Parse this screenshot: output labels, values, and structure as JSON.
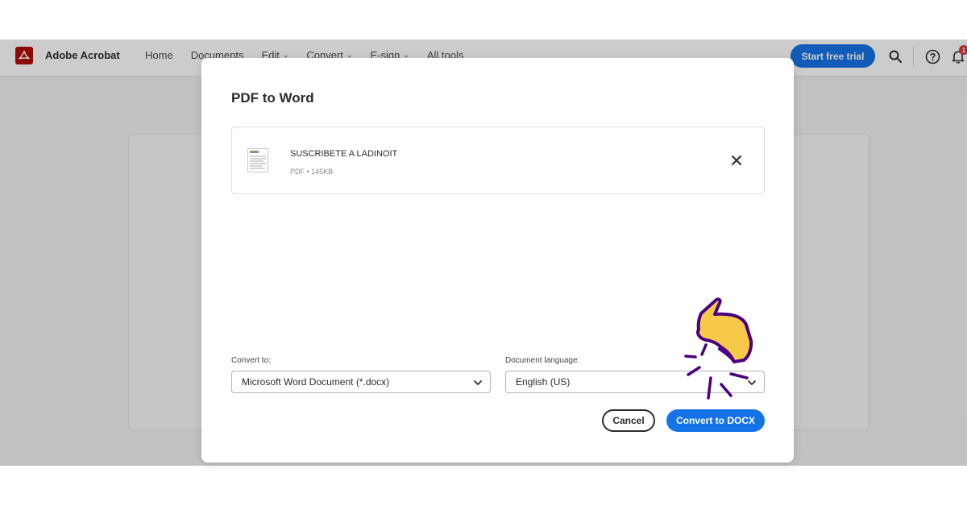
{
  "app": {
    "brand": "Adobe Acrobat",
    "brand_color": "#b30b00",
    "accent_color": "#1473e6",
    "logo_icon": "acrobat-logo-icon"
  },
  "nav": {
    "items": [
      {
        "label": "Home",
        "has_dropdown": false
      },
      {
        "label": "Documents",
        "has_dropdown": false
      },
      {
        "label": "Edit",
        "has_dropdown": true
      },
      {
        "label": "Convert",
        "has_dropdown": true
      },
      {
        "label": "E-sign",
        "has_dropdown": true
      },
      {
        "label": "All tools",
        "has_dropdown": false
      }
    ],
    "dropdown_caret": "⌄"
  },
  "header": {
    "trial_label": "Start free trial",
    "search_icon": "search-icon",
    "help_icon": "help-icon",
    "notification_icon": "bell-icon",
    "notification_count": "1"
  },
  "dialog": {
    "title": "PDF to Word",
    "file": {
      "name": "SUSCRIBETE A LADINOIT",
      "meta": "PDF • 145KB",
      "thumb_icon": "document-thumbnail-icon",
      "remove_icon": "close-icon"
    },
    "convert_to": {
      "label": "Convert to:",
      "value": "Microsoft Word Document (*.docx)"
    },
    "language": {
      "label": "Document language:",
      "value": "English (US)"
    },
    "cancel_label": "Cancel",
    "convert_label": "Convert to DOCX"
  },
  "overlay_icon": "pointing-hand-icon"
}
